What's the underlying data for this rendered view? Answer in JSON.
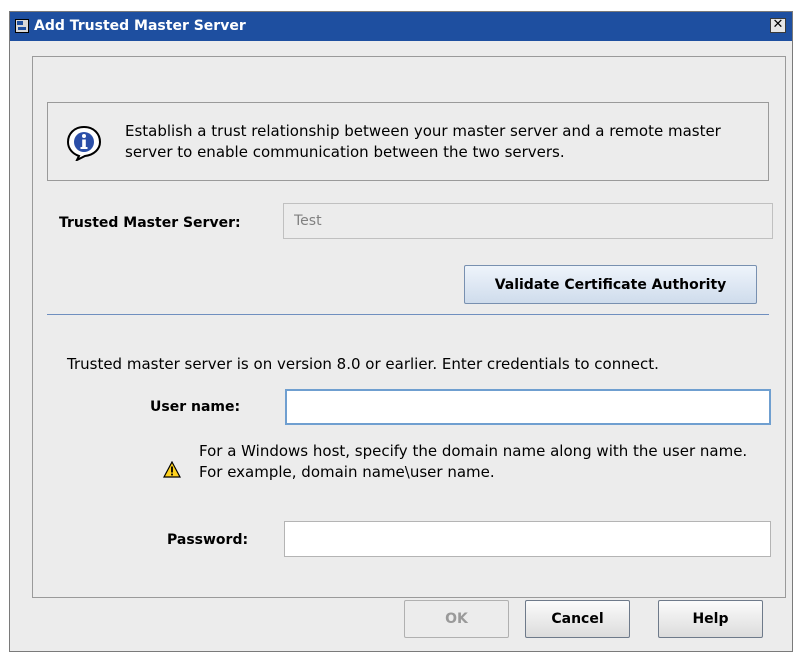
{
  "window": {
    "title": "Add Trusted Master Server",
    "close_label": "✕"
  },
  "info": {
    "text": "Establish a trust relationship between your master server and a remote master server to enable communication between the two servers."
  },
  "trusted_server": {
    "label": "Trusted Master Server:",
    "value": "Test"
  },
  "validate_button": "Validate Certificate Authority",
  "credentials_note": "Trusted master server is on version 8.0 or earlier. Enter credentials to connect.",
  "username": {
    "label": "User name:",
    "value": ""
  },
  "warning": {
    "text": "For a Windows host, specify the domain name along with the user name. For example, domain name\\user name."
  },
  "password": {
    "label": "Password:",
    "value": ""
  },
  "buttons": {
    "ok": "OK",
    "cancel": "Cancel",
    "help": "Help"
  },
  "icons": {
    "title": "app-icon",
    "info": "info-icon",
    "warning": "warning-icon",
    "close": "close-icon"
  },
  "colors": {
    "titlebar": "#1e4fa0",
    "separator": "#6f8fbf",
    "warning_fill": "#ffd21f"
  }
}
